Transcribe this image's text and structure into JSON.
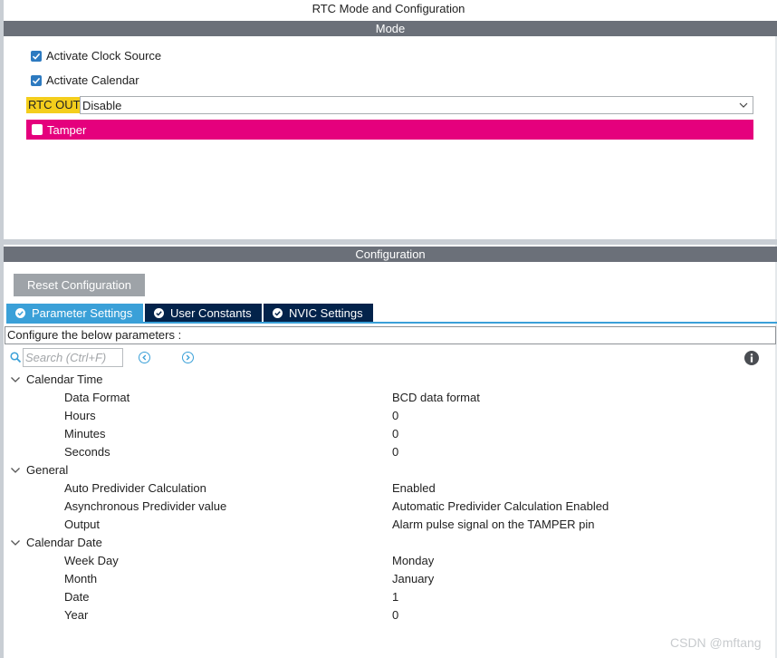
{
  "window": {
    "title": "RTC Mode and Configuration"
  },
  "mode": {
    "header": "Mode",
    "activate_clock_source": {
      "label": "Activate Clock Source",
      "checked": true
    },
    "activate_calendar": {
      "label": "Activate Calendar",
      "checked": true
    },
    "rtc_out": {
      "label": "RTC OUT",
      "value": "Disable",
      "label_color": "#f4ce1c"
    },
    "tamper": {
      "label": "Tamper",
      "checked": false,
      "bar_color": "#e5007d"
    }
  },
  "configuration": {
    "header": "Configuration",
    "reset_label": "Reset Configuration",
    "tabs": [
      {
        "label": "Parameter Settings",
        "active": true,
        "icon": "check-circle-icon"
      },
      {
        "label": "User Constants",
        "active": false,
        "icon": "check-circle-icon"
      },
      {
        "label": "NVIC Settings",
        "active": false,
        "icon": "check-circle-icon"
      }
    ],
    "configure_text": "Configure the below parameters :",
    "search": {
      "placeholder": "Search (Ctrl+F)",
      "value": ""
    },
    "groups": [
      {
        "name": "Calendar Time",
        "expanded": true,
        "params": [
          {
            "name": "Data Format",
            "value": "BCD data format"
          },
          {
            "name": "Hours",
            "value": "0"
          },
          {
            "name": "Minutes",
            "value": "0"
          },
          {
            "name": "Seconds",
            "value": "0"
          }
        ]
      },
      {
        "name": "General",
        "expanded": true,
        "params": [
          {
            "name": "Auto Predivider Calculation",
            "value": "Enabled"
          },
          {
            "name": "Asynchronous Predivider value",
            "value": "Automatic Predivider Calculation Enabled"
          },
          {
            "name": "Output",
            "value": "Alarm pulse signal on the TAMPER pin"
          }
        ]
      },
      {
        "name": "Calendar Date",
        "expanded": true,
        "params": [
          {
            "name": "Week Day",
            "value": "Monday"
          },
          {
            "name": "Month",
            "value": "January"
          },
          {
            "name": "Date",
            "value": "1"
          },
          {
            "name": "Year",
            "value": "0"
          }
        ]
      }
    ]
  },
  "watermark": "CSDN @mftang",
  "colors": {
    "accent": "#3aa0d8",
    "tab_inactive": "#03234b",
    "header_bg": "#6b7079",
    "checkbox": "#2d7ac0"
  }
}
